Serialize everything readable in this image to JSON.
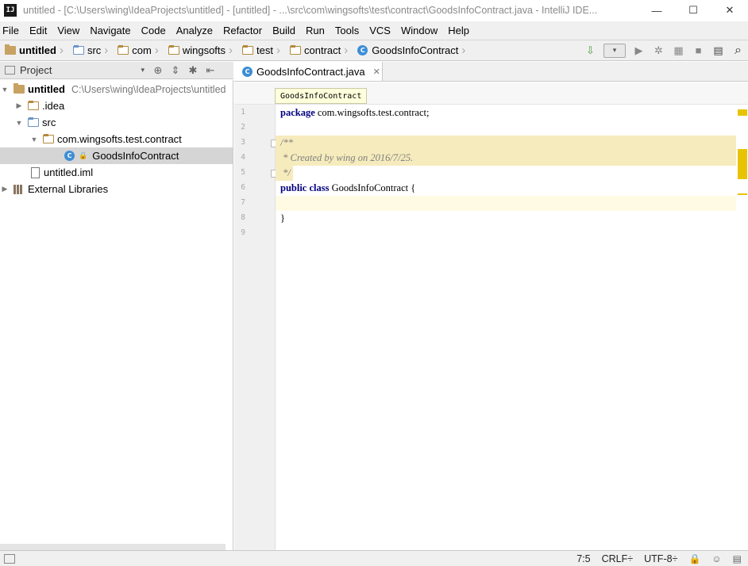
{
  "window": {
    "title": "untitled - [C:\\Users\\wing\\IdeaProjects\\untitled] - [untitled] - ...\\src\\com\\wingsofts\\test\\contract\\GoodsInfoContract.java - IntelliJ IDE...",
    "app_icon_text": "IJ",
    "controls": {
      "minimize": "—",
      "maximize": "☐",
      "close": "✕"
    }
  },
  "menu": [
    {
      "label": "File"
    },
    {
      "label": "Edit"
    },
    {
      "label": "View"
    },
    {
      "label": "Navigate"
    },
    {
      "label": "Code"
    },
    {
      "label": "Analyze"
    },
    {
      "label": "Refactor"
    },
    {
      "label": "Build"
    },
    {
      "label": "Run"
    },
    {
      "label": "Tools"
    },
    {
      "label": "VCS"
    },
    {
      "label": "Window"
    },
    {
      "label": "Help"
    }
  ],
  "navbar": {
    "crumbs": [
      "untitled",
      "src",
      "com",
      "wingsofts",
      "test",
      "contract",
      "GoodsInfoContract"
    ],
    "sep": "›",
    "tools": {
      "build": "⇩",
      "run": "▶",
      "debug": "✲",
      "coverage": "▦",
      "stop": "■",
      "structure": "▤",
      "search": "⌕",
      "dropdown": "▾"
    }
  },
  "project_panel": {
    "title": "Project",
    "dropdown": "▾",
    "tools": [
      "⊕",
      "⇕",
      "✱",
      "⇤"
    ],
    "tree": [
      {
        "arrow": "▼",
        "label": "untitled",
        "path": "C:\\Users\\wing\\IdeaProjects\\untitled"
      },
      {
        "arrow": "▶",
        "label": ".idea"
      },
      {
        "arrow": "▼",
        "label": "src"
      },
      {
        "arrow": "▼",
        "label": "com.wingsofts.test.contract"
      },
      {
        "arrow": "",
        "label": "GoodsInfoContract"
      },
      {
        "arrow": "",
        "label": "untitled.iml"
      },
      {
        "arrow": "▶",
        "label": "External Libraries"
      }
    ]
  },
  "editor": {
    "tab": {
      "label": "GoodsInfoContract.java",
      "close": "✕"
    },
    "breadcrumb": "GoodsInfoContract",
    "class_icon": "C",
    "line_numbers": [
      "1",
      "2",
      "3",
      "4",
      "5",
      "6",
      "7",
      "8",
      "9"
    ],
    "code": {
      "l1_kw": "package",
      "l1_rest": " com.wingsofts.test.contract;",
      "l3": "/**",
      "l4": " * Created by wing on 2016/7/25.",
      "l5": " */",
      "l6_kw1": "public",
      "l6_kw2": "class",
      "l6_rest": " GoodsInfoContract {",
      "l8": "}"
    }
  },
  "statusbar": {
    "position": "7:5",
    "line_sep": "CRLF",
    "encoding": "UTF-8",
    "suffix_arrows": "÷",
    "icons": [
      "lock-icon",
      "hector-icon",
      "event-log-icon"
    ]
  },
  "colors": {
    "keyword": "#000080",
    "comment": "#808080",
    "doc_highlight": "#f6ebbc",
    "caret_line": "#fffae3",
    "class_icon": "#3d8ed6",
    "warning_stripe": "#e8c400"
  }
}
